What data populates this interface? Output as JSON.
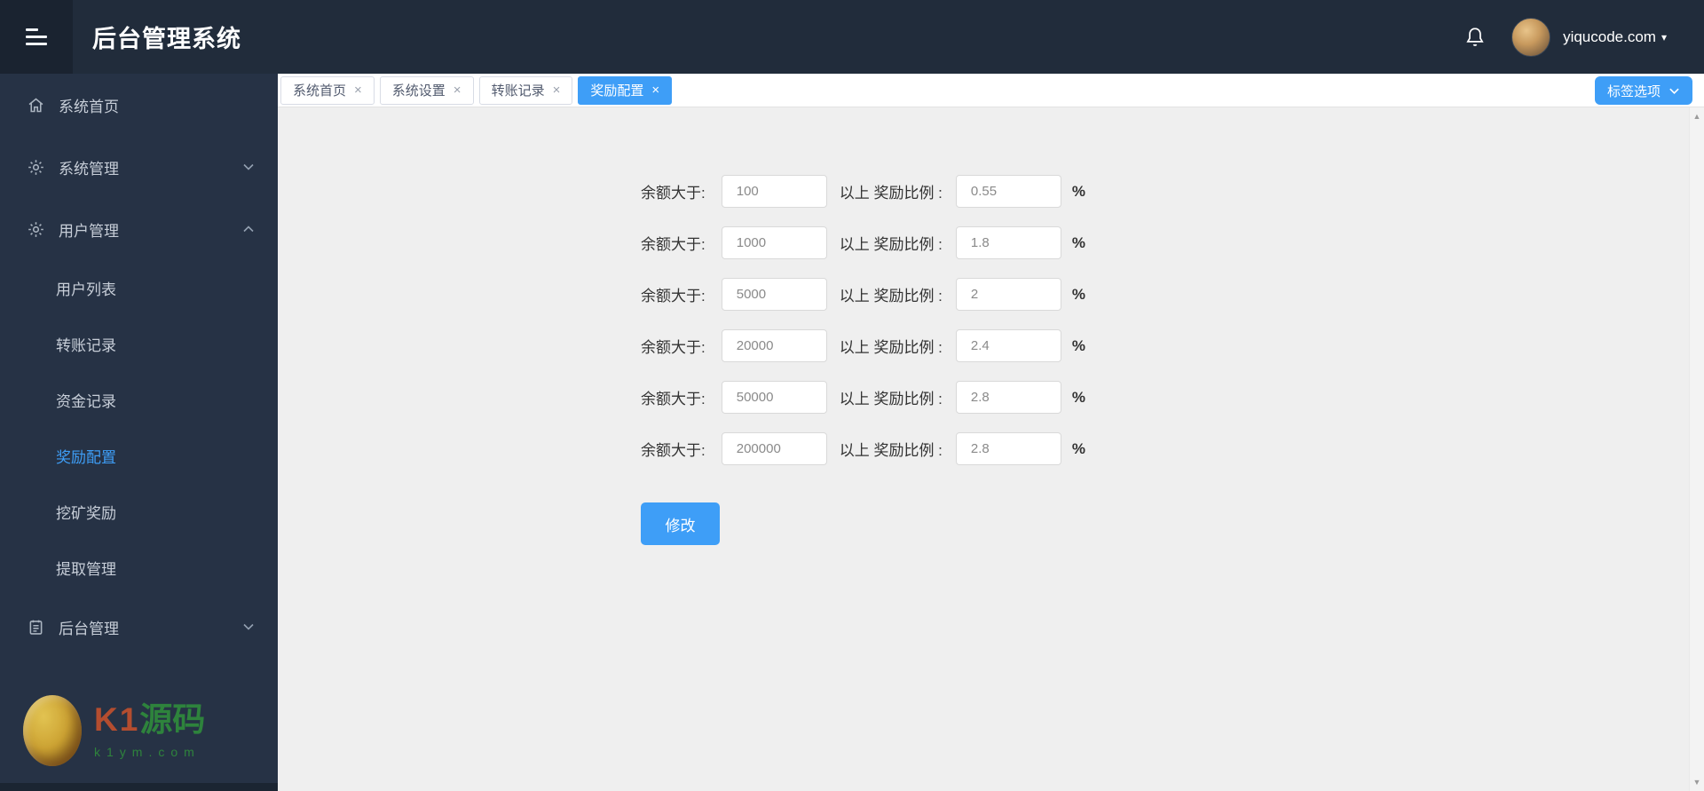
{
  "header": {
    "title": "后台管理系统",
    "account_name": "yiqucode.com"
  },
  "sidebar": {
    "home": "系统首页",
    "system": "系统管理",
    "user": "用户管理",
    "children": [
      "用户列表",
      "转账记录",
      "资金记录",
      "奖励配置",
      "挖矿奖励",
      "提取管理"
    ],
    "active_child": "奖励配置",
    "backend": "后台管理"
  },
  "tabs": [
    {
      "label": "系统首页",
      "active": false
    },
    {
      "label": "系统设置",
      "active": false
    },
    {
      "label": "转账记录",
      "active": false
    },
    {
      "label": "奖励配置",
      "active": true
    }
  ],
  "tagbar": {
    "options_label": "标签选项"
  },
  "form": {
    "label_left": "余额大于:",
    "label_mid": "以上 奖励比例 :",
    "percent": "%",
    "submit_label": "修改",
    "rows": [
      {
        "amount": "100",
        "ratio": "0.55"
      },
      {
        "amount": "1000",
        "ratio": "1.8"
      },
      {
        "amount": "5000",
        "ratio": "2"
      },
      {
        "amount": "20000",
        "ratio": "2.4"
      },
      {
        "amount": "50000",
        "ratio": "2.8"
      },
      {
        "amount": "200000",
        "ratio": "2.8"
      }
    ]
  },
  "watermark": {
    "brand_latin": "K1",
    "brand_cn": "源码",
    "site": "k1ym.com"
  },
  "icons": {
    "close": "×",
    "caret_down": "▾",
    "scroll_up": "▲",
    "scroll_down": "▼"
  },
  "colors": {
    "accent_blue": "#3e9ef7",
    "header_bg": "#212c3b",
    "sidebar_bg": "#263245",
    "content_bg": "#efefef"
  }
}
